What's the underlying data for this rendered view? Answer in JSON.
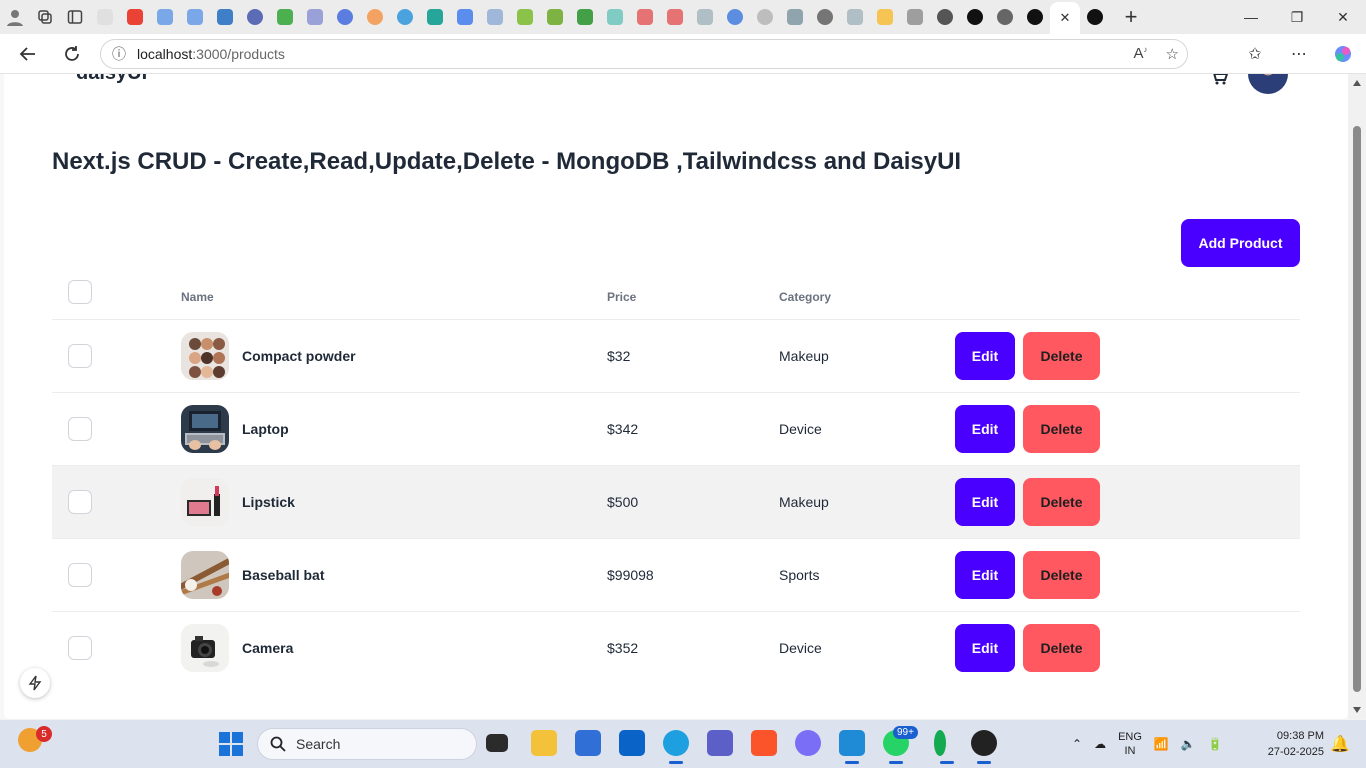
{
  "browser": {
    "url_host": "localhost",
    "url_rest": ":3000/products",
    "tab_close": "✕",
    "new_tab": "+"
  },
  "header": {
    "brand": "daisyUI"
  },
  "page": {
    "title": "Next.js CRUD - Create,Read,Update,Delete - MongoDB ,Tailwindcss and DaisyUI",
    "add_button": "Add Product"
  },
  "table": {
    "headers": [
      "Name",
      "Price",
      "Category"
    ],
    "rows": [
      {
        "name": "Compact powder",
        "price": "$32",
        "category": "Makeup"
      },
      {
        "name": "Laptop",
        "price": "$342",
        "category": "Device"
      },
      {
        "name": "Lipstick",
        "price": "$500",
        "category": "Makeup"
      },
      {
        "name": "Baseball bat",
        "price": "$99098",
        "category": "Sports"
      },
      {
        "name": "Camera",
        "price": "$352",
        "category": "Device"
      }
    ],
    "edit_label": "Edit",
    "delete_label": "Delete"
  },
  "colors": {
    "primary": "#4a00ff",
    "error": "#ff5861"
  },
  "taskbar": {
    "weather_badge": "5",
    "search_placeholder": "Search",
    "whatsapp_badge": "99+",
    "lang_line1": "ENG",
    "lang_line2": "IN",
    "time": "09:38 PM",
    "date": "27-02-2025"
  }
}
